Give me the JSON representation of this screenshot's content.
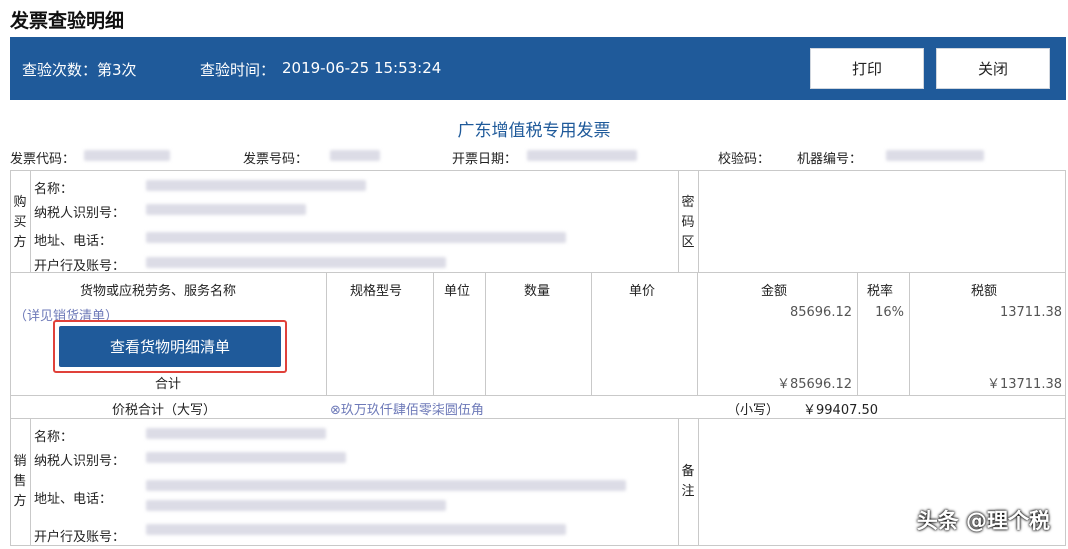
{
  "page_title": "发票查验明细",
  "header": {
    "check_count": "查验次数：第3次",
    "check_time_label": "查验时间：",
    "check_time": "2019-06-25 15:53:24",
    "print_label": "打印",
    "close_label": "关闭"
  },
  "invoice": {
    "title": "广东增值税专用发票",
    "code_label": "发票代码：",
    "number_label": "发票号码：",
    "date_label": "开票日期：",
    "check_code_label": "校验码：",
    "machine_label": "机器编号："
  },
  "buyer": {
    "side_label": [
      "购",
      "买",
      "方"
    ],
    "name_label": "名称：",
    "tax_id_label": "纳税人识别号：",
    "address_label": "地址、电话：",
    "bank_label": "开户行及账号："
  },
  "password_zone": [
    "密",
    "码",
    "区"
  ],
  "goods": {
    "col_name": "货物或应税劳务、服务名称",
    "col_spec": "规格型号",
    "col_unit": "单位",
    "col_qty": "数量",
    "col_price": "单价",
    "col_amount": "金额",
    "col_rate": "税率",
    "col_tax": "税额",
    "see_list": "（详见销货清单）",
    "row_amount": "85696.12",
    "row_rate": "16%",
    "row_tax": "13711.38",
    "detail_button": "查看货物明细清单",
    "total_label": "合计",
    "total_amount": "￥85696.12",
    "total_tax": "￥13711.38"
  },
  "total": {
    "label": "价税合计（大写）",
    "uppercase": "⊗玖万玖仟肆佰零柒圆伍角",
    "small_label": "（小写）",
    "small_value": "￥99407.50"
  },
  "seller": {
    "side_label": [
      "销",
      "售",
      "方"
    ],
    "name_label": "名称：",
    "tax_id_label": "纳税人识别号：",
    "address_label": "地址、电话：",
    "bank_label": "开户行及账号："
  },
  "remarks": [
    "备",
    "注"
  ],
  "watermark": "头条 @理个税",
  "colors": {
    "header_blue": "#1f5a9a",
    "highlight_red": "#e0413a",
    "link_purple": "#6d79b8"
  }
}
